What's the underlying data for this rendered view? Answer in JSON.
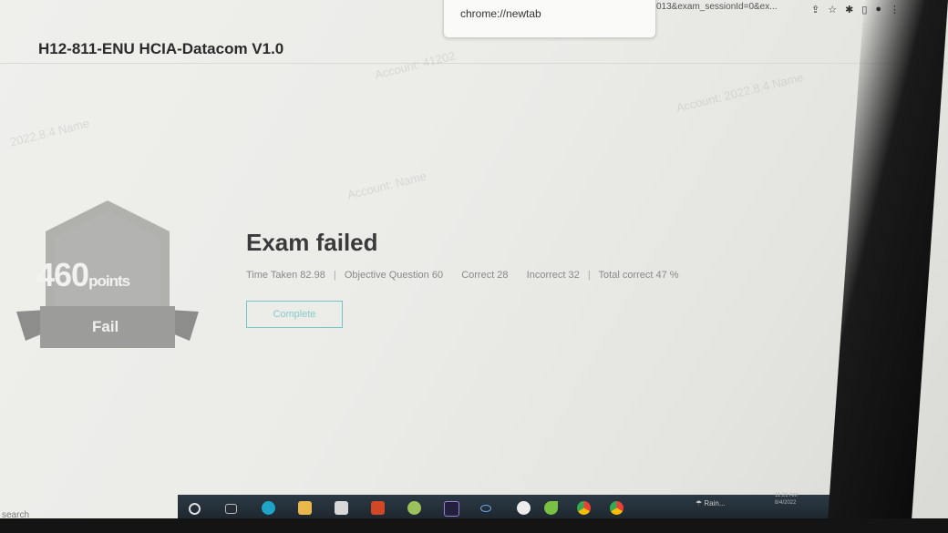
{
  "browser": {
    "address_fragment": "013&exam_sessionId=0&ex...",
    "omnibox_text": "chrome://newtab",
    "toolbar_icons": [
      "share-icon",
      "star-icon",
      "extension-icon",
      "sidebar-icon",
      "profile-icon",
      "menu-icon"
    ]
  },
  "app": {
    "title": "H12-811-ENU HCIA-Datacom V1.0"
  },
  "result": {
    "score": "460",
    "score_unit": "points",
    "status": "Fail",
    "heading": "Exam failed",
    "time_taken": "Time Taken 82.98",
    "objective_question": "Objective Question 60",
    "correct": "Correct 28",
    "incorrect": "Incorrect 32",
    "total_correct": "Total correct 47 %",
    "separator": "|",
    "complete_label": "Complete"
  },
  "taskbar": {
    "search_label": "search",
    "weather": "Rain...",
    "time": "11:21 AM",
    "date": "8/4/2022",
    "apps": [
      "cortana-icon",
      "task-view-icon",
      "edge-icon",
      "file-explorer-icon",
      "store-icon",
      "powerpoint-icon",
      "app-icon",
      "premiere-icon",
      "link-icon",
      "app-icon",
      "app-icon",
      "chrome-icon",
      "chrome-icon"
    ]
  },
  "colors": {
    "accent": "#74c6c6",
    "badge": "#9a9a98",
    "heading": "#3a3a3a"
  }
}
